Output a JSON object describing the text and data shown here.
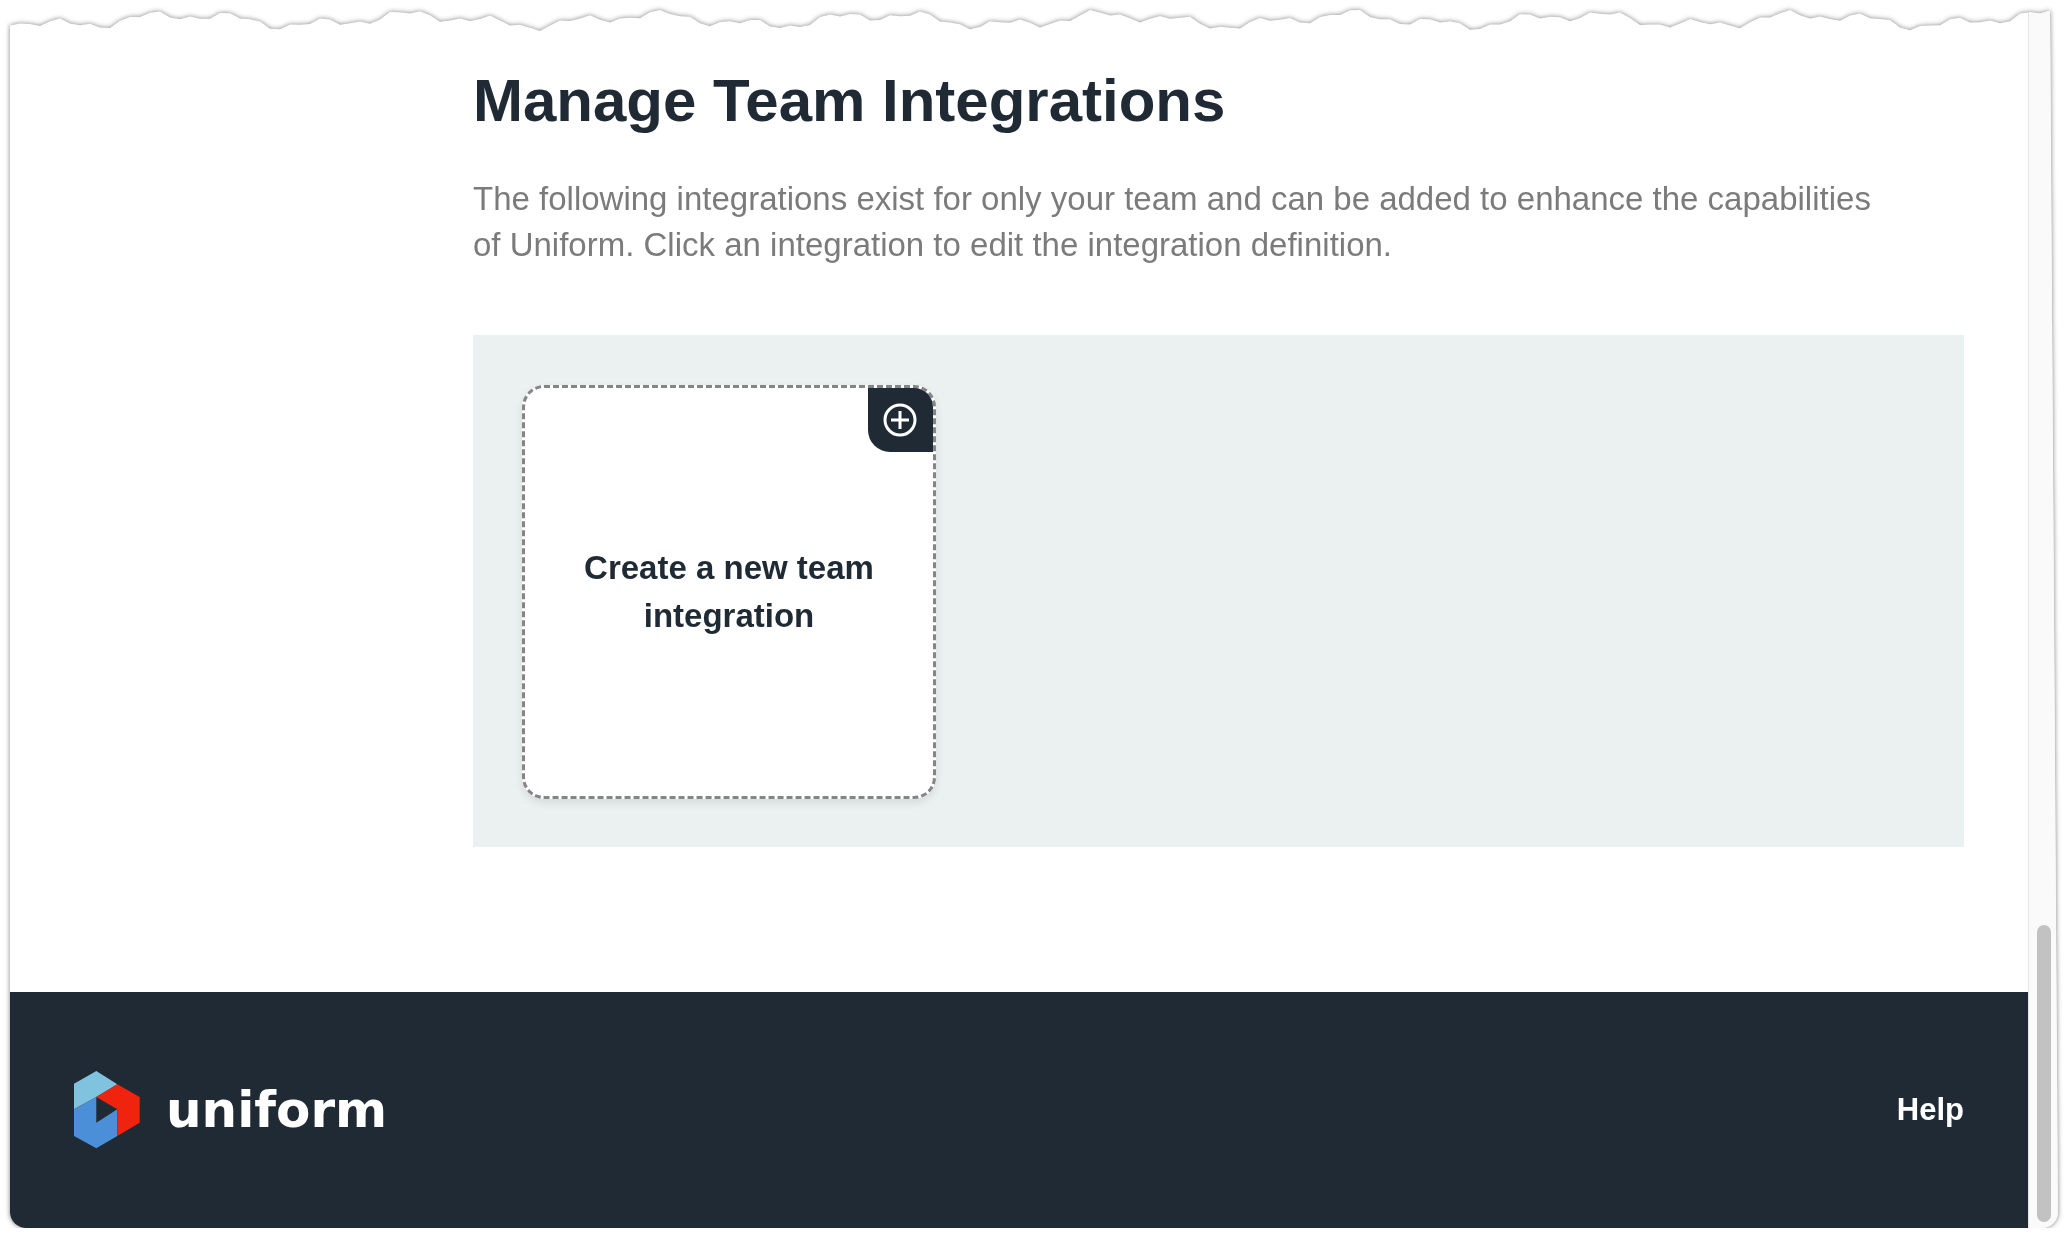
{
  "page": {
    "title": "Manage Team Integrations",
    "description": "The following integrations exist for only your team and can be added to enhance the capabilities of Uniform. Click an integration to edit the integration definition."
  },
  "integrations": {
    "create_card": {
      "label": "Create a new team integration"
    }
  },
  "footer": {
    "brand": "uniform",
    "links": [
      {
        "label": "Help"
      }
    ]
  }
}
